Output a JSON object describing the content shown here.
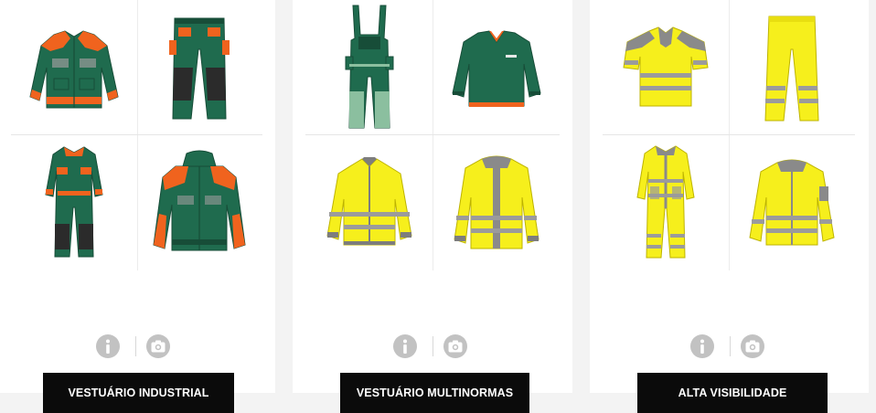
{
  "colors": {
    "page_bg": "#f3f3f3",
    "card_bg": "#ffffff",
    "button_bg": "#0b0b0b",
    "button_text": "#ffffff",
    "icon_bg": "#c2c2c2",
    "industrial_green": "#1f6b4e",
    "industrial_orange": "#f0631e",
    "hivis_yellow": "#f6ef1c",
    "reflective_gray": "#9b9b9b"
  },
  "categories": [
    {
      "label": "VESTUÁRIO INDUSTRIAL",
      "garments": [
        "jacket-icon",
        "trousers-icon",
        "coverall-icon",
        "hooded-jacket-icon"
      ],
      "actions": [
        "info-icon",
        "camera-icon"
      ]
    },
    {
      "label": "VESTUÁRIO MULTINORMAS",
      "garments": [
        "bib-overall-icon",
        "sweater-icon",
        "shirt-icon",
        "jacket-icon"
      ],
      "actions": [
        "info-icon",
        "camera-icon"
      ]
    },
    {
      "label": "ALTA VISIBILIDADE",
      "garments": [
        "polo-shirt-icon",
        "trousers-icon",
        "coverall-icon",
        "jacket-icon"
      ],
      "actions": [
        "info-icon",
        "camera-icon"
      ]
    }
  ]
}
